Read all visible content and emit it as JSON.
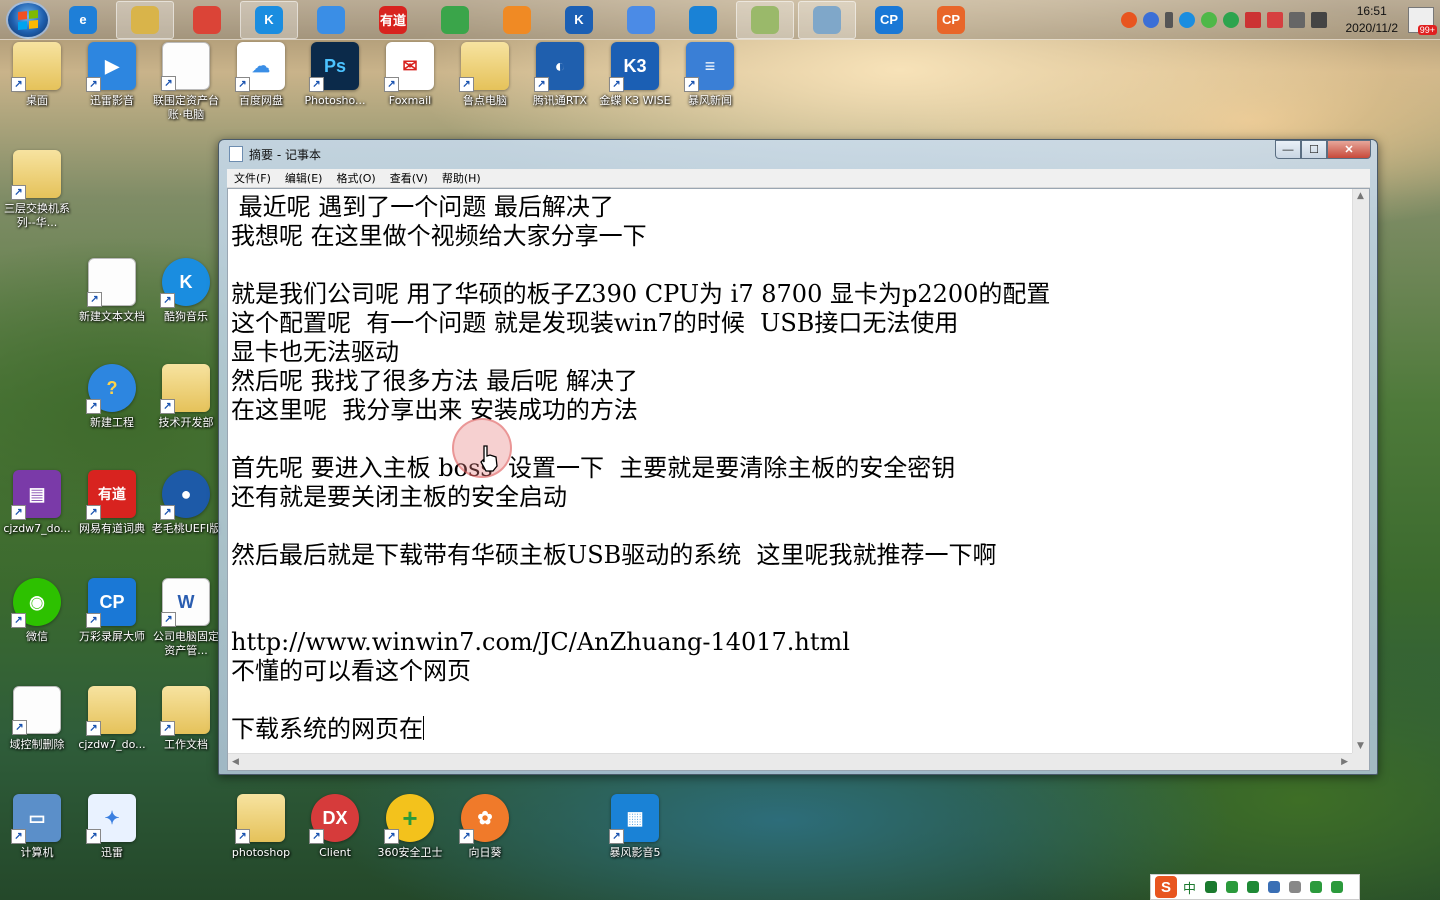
{
  "taskbar": {
    "pinned": [
      {
        "name": "ie",
        "icon": "ie-icon",
        "glyph": "e",
        "color": "#1e7fd8",
        "active": false
      },
      {
        "name": "explorer",
        "icon": "folder-icon",
        "glyph": "",
        "color": "#d9b44a",
        "active": true
      },
      {
        "name": "chrome",
        "icon": "chrome-icon",
        "glyph": "",
        "color": "#db4437",
        "active": false
      },
      {
        "name": "kugou",
        "icon": "kugou-icon",
        "glyph": "K",
        "color": "#1a8de0",
        "active": true
      },
      {
        "name": "baidu-netdisk",
        "icon": "cloud-icon",
        "glyph": "",
        "color": "#3a8ee6",
        "active": false
      },
      {
        "name": "youdao",
        "icon": "youdao-icon",
        "glyph": "有道",
        "color": "#d8231f",
        "active": false
      },
      {
        "name": "360",
        "icon": "shield-icon",
        "glyph": "",
        "color": "#3aa54a",
        "active": false
      },
      {
        "name": "uc",
        "icon": "uc-icon",
        "glyph": "",
        "color": "#f08a24",
        "active": false
      },
      {
        "name": "kingdee",
        "icon": "kingdee-icon",
        "glyph": "K",
        "color": "#1b5fb4",
        "active": false
      },
      {
        "name": "xunlei",
        "icon": "xunlei-icon",
        "glyph": "",
        "color": "#4b8be6",
        "active": false
      },
      {
        "name": "storm",
        "icon": "storm-icon",
        "glyph": "",
        "color": "#1a82d6",
        "active": false
      },
      {
        "name": "notepad-group",
        "icon": "notepad-icon",
        "glyph": "",
        "color": "#9ab96a",
        "active": true
      },
      {
        "name": "notepad",
        "icon": "notepad-icon",
        "glyph": "",
        "color": "#7fa7c9",
        "active": true
      },
      {
        "name": "cp-blue",
        "icon": "cp-icon",
        "glyph": "CP",
        "color": "#1a78d6",
        "active": false
      },
      {
        "name": "cp-orange",
        "icon": "cp-icon",
        "glyph": "CP",
        "color": "#e8662a",
        "active": false
      }
    ],
    "clock": {
      "time": "16:51",
      "date": "2020/11/2"
    },
    "notifications": "99+"
  },
  "desktop_icons": [
    {
      "label": "桌面",
      "icon": "folder-icon",
      "glyph": "",
      "kind": "folder",
      "col": 0,
      "row": 0
    },
    {
      "label": "迅雷影音",
      "icon": "xunlei-player-icon",
      "glyph": "▶",
      "kind": "blue"
    },
    {
      "label": "联围定资产台账·电脑",
      "icon": "spreadsheet-icon",
      "glyph": "",
      "kind": "doc"
    },
    {
      "label": "百度网盘",
      "icon": "cloud-icon",
      "glyph": "☁",
      "kind": "cloud"
    },
    {
      "label": "Photosho...",
      "icon": "photoshop-icon",
      "glyph": "Ps",
      "kind": "ps"
    },
    {
      "label": "Foxmail",
      "icon": "foxmail-icon",
      "glyph": "✉",
      "kind": "fox"
    },
    {
      "label": "鲁点电脑",
      "icon": "folder-icon",
      "glyph": "",
      "kind": "folder"
    },
    {
      "label": "腾讯通RTX",
      "icon": "rtx-icon",
      "glyph": "◐",
      "kind": "rtx"
    },
    {
      "label": "金蝶 K3 WISE",
      "icon": "kingdee-icon",
      "glyph": "K3",
      "kind": "k3"
    },
    {
      "label": "暴风新闻",
      "icon": "news-icon",
      "glyph": "≡",
      "kind": "news"
    },
    {
      "label": "三层交换机系列--华...",
      "icon": "folder-icon",
      "glyph": "",
      "kind": "folder"
    },
    {
      "label": "新建文本文档",
      "icon": "text-file-icon",
      "glyph": "",
      "kind": "doc"
    },
    {
      "label": "酷狗音乐",
      "icon": "kugou-icon",
      "glyph": "K",
      "kind": "kugou"
    },
    {
      "label": "新建工程",
      "icon": "help-icon",
      "glyph": "?",
      "kind": "help"
    },
    {
      "label": "技术开发部",
      "icon": "folder-icon",
      "glyph": "",
      "kind": "folder"
    },
    {
      "label": "cjzdw7_do...",
      "icon": "archive-icon",
      "glyph": "▤",
      "kind": "rar"
    },
    {
      "label": "网易有道词典",
      "icon": "youdao-icon",
      "glyph": "有道",
      "kind": "youdao"
    },
    {
      "label": "老毛桃UEFI版",
      "icon": "usb-icon",
      "glyph": "●",
      "kind": "laomao"
    },
    {
      "label": "微信",
      "icon": "wechat-icon",
      "glyph": "◉",
      "kind": "wechat"
    },
    {
      "label": "万彩录屏大师",
      "icon": "cp-icon",
      "glyph": "CP",
      "kind": "cp"
    },
    {
      "label": "公司电脑固定资产管...",
      "icon": "word-icon",
      "glyph": "W",
      "kind": "doc"
    },
    {
      "label": "域控制删除",
      "icon": "text-file-icon",
      "glyph": "",
      "kind": "doc"
    },
    {
      "label": "cjzdw7_do...",
      "icon": "folder-icon",
      "glyph": "",
      "kind": "folder"
    },
    {
      "label": "工作文档",
      "icon": "folder-icon",
      "glyph": "",
      "kind": "folder"
    },
    {
      "label": "计算机",
      "icon": "computer-icon",
      "glyph": "▭",
      "kind": "computer"
    },
    {
      "label": "迅雷",
      "icon": "xunlei-icon",
      "glyph": "✦",
      "kind": "xunlei"
    },
    {
      "label": "photoshop",
      "icon": "folder-icon",
      "glyph": "",
      "kind": "folder"
    },
    {
      "label": "Client",
      "icon": "dx-icon",
      "glyph": "DX",
      "kind": "dx"
    },
    {
      "label": "360安全卫士",
      "icon": "shield-plus-icon",
      "glyph": "+",
      "kind": "s360"
    },
    {
      "label": "向日葵",
      "icon": "sunflower-icon",
      "glyph": "✿",
      "kind": "sun"
    },
    {
      "label": "暴风影音5",
      "icon": "storm-icon",
      "glyph": "▦",
      "kind": "storm"
    }
  ],
  "notepad": {
    "title": "摘要 - 记事本",
    "menu": [
      "文件(F)",
      "编辑(E)",
      "格式(O)",
      "查看(V)",
      "帮助(H)"
    ],
    "lines": [
      " 最近呢 遇到了一个问题 最后解决了",
      "我想呢 在这里做个视频给大家分享一下",
      "",
      "就是我们公司呢 用了华硕的板子Z390 CPU为 i7 8700 显卡为p2200的配置",
      "这个配置呢  有一个问题 就是发现装win7的时候  USB接口无法使用",
      "显卡也无法驱动",
      "然后呢 我找了很多方法 最后呢 解决了",
      "在这里呢  我分享出来 安装成功的方法",
      "",
      "首先呢 要进入主板 boss  设置一下  主要就是要清除主板的安全密钥",
      "还有就是要关闭主板的安全启动",
      "",
      "然后最后就是下载带有华硕主板USB驱动的系统  这里呢我就推荐一下啊",
      "",
      "",
      "http://www.winwin7.com/JC/AnZhuang-14017.html",
      "不懂的可以看这个网页",
      "",
      "下载系统的网页在"
    ]
  },
  "ime": {
    "logo": "S",
    "mode": "中"
  }
}
